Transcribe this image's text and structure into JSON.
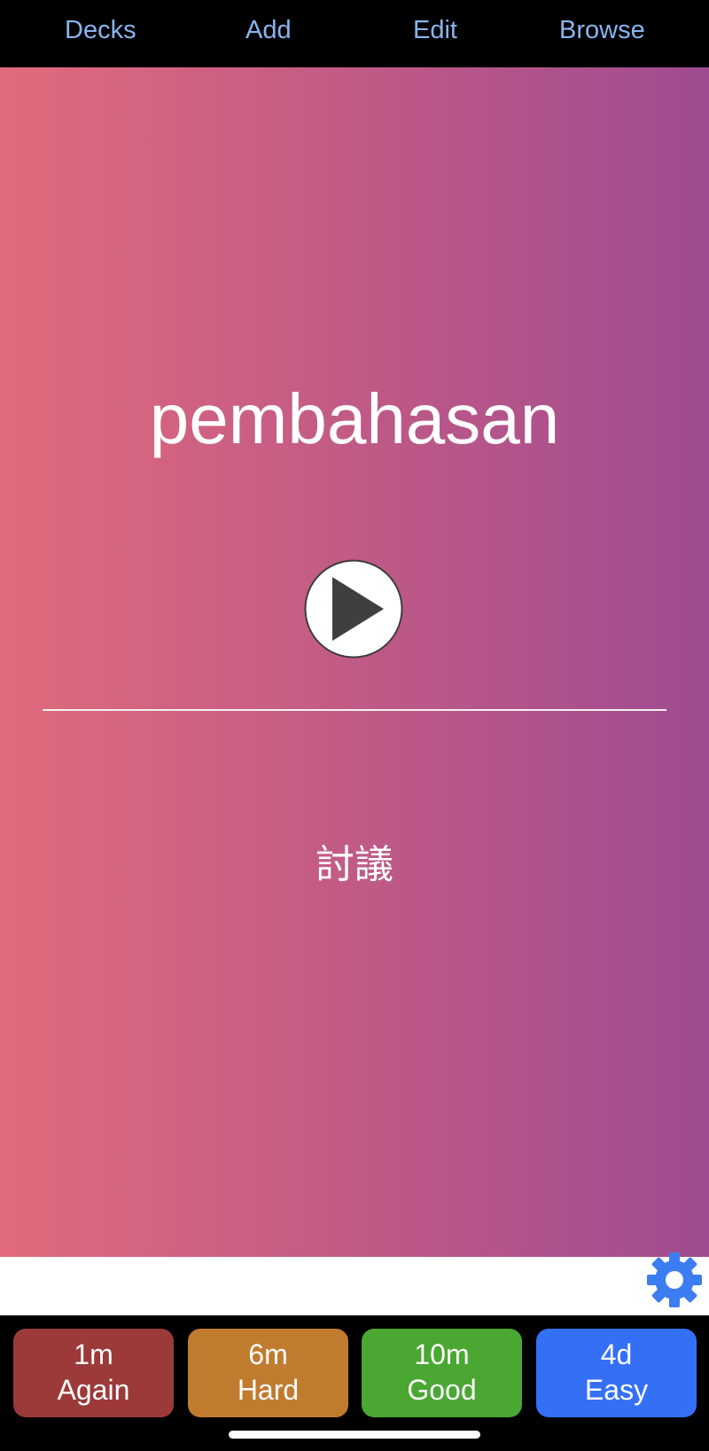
{
  "nav": {
    "decks": "Decks",
    "add": "Add",
    "edit": "Edit",
    "browse": "Browse",
    "color": "#8ab4ee"
  },
  "card": {
    "front": "pembahasan",
    "back": "討議",
    "gradient": [
      "#e16a7b",
      "#a04b91"
    ]
  },
  "icons": {
    "play": "play-icon",
    "settings": "gear-icon"
  },
  "answers": [
    {
      "interval": "1m",
      "label": "Again",
      "color": "#9c3939"
    },
    {
      "interval": "6m",
      "label": "Hard",
      "color": "#c17b2f"
    },
    {
      "interval": "10m",
      "label": "Good",
      "color": "#4aa732"
    },
    {
      "interval": "4d",
      "label": "Easy",
      "color": "#3370f6"
    }
  ]
}
